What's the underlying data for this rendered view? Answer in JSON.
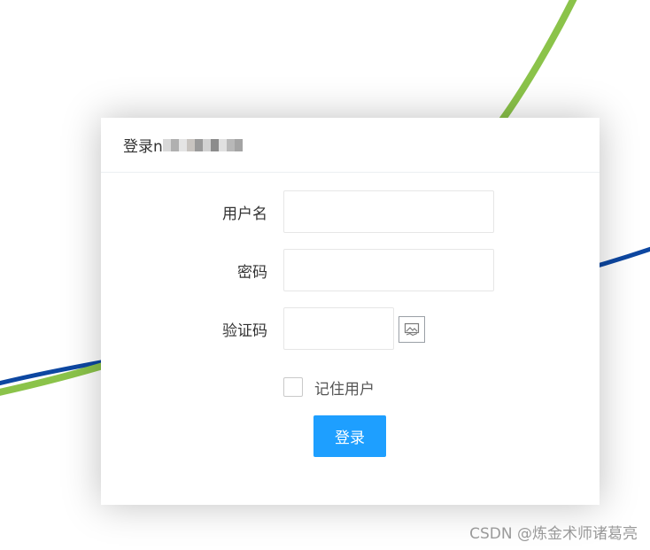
{
  "dialog": {
    "title": "登录n",
    "fields": {
      "username": {
        "label": "用户名",
        "value": "",
        "placeholder": ""
      },
      "password": {
        "label": "密码",
        "value": "",
        "placeholder": ""
      },
      "captcha": {
        "label": "验证码",
        "value": "",
        "placeholder": ""
      }
    },
    "remember_label": "记住用户",
    "remember_checked": false,
    "login_label": "登录"
  },
  "watermark": "CSDN @炼金术师诸葛亮",
  "colors": {
    "primary": "#1e9fff",
    "curve_green": "#8bc34a",
    "curve_blue": "#0d47a1"
  },
  "icons": {
    "captcha": "broken-image-icon"
  }
}
